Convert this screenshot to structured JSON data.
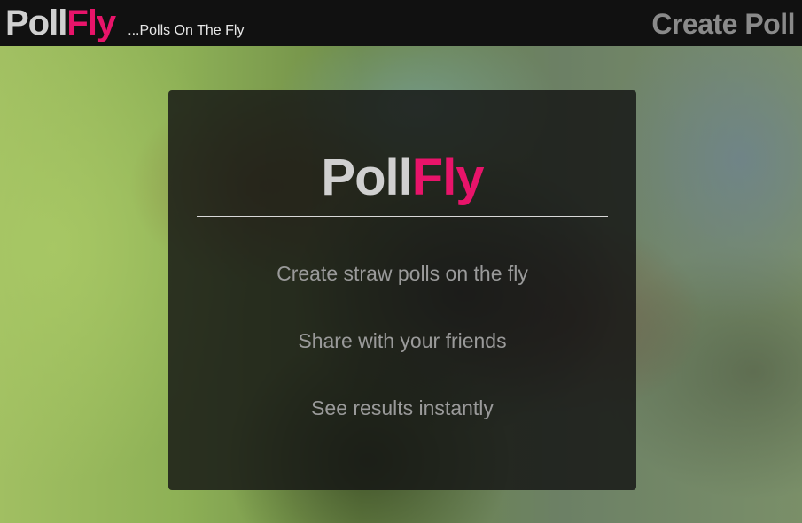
{
  "header": {
    "brand": {
      "poll": "Poll",
      "fly": "Fly"
    },
    "tagline": "...Polls On The Fly",
    "create_poll": "Create Poll"
  },
  "card": {
    "logo": {
      "poll": "Poll",
      "fly": "Fly"
    },
    "features": [
      "Create straw polls on the fly",
      "Share with your friends",
      "See results instantly"
    ]
  },
  "colors": {
    "accent": "#e8146a",
    "logo_gray": "#d0d0d0",
    "header_bg": "#111111",
    "card_bg": "rgba(20,20,20,0.82)",
    "feature_text": "#9a9a9a",
    "create_poll_text": "#8a8a8a"
  }
}
